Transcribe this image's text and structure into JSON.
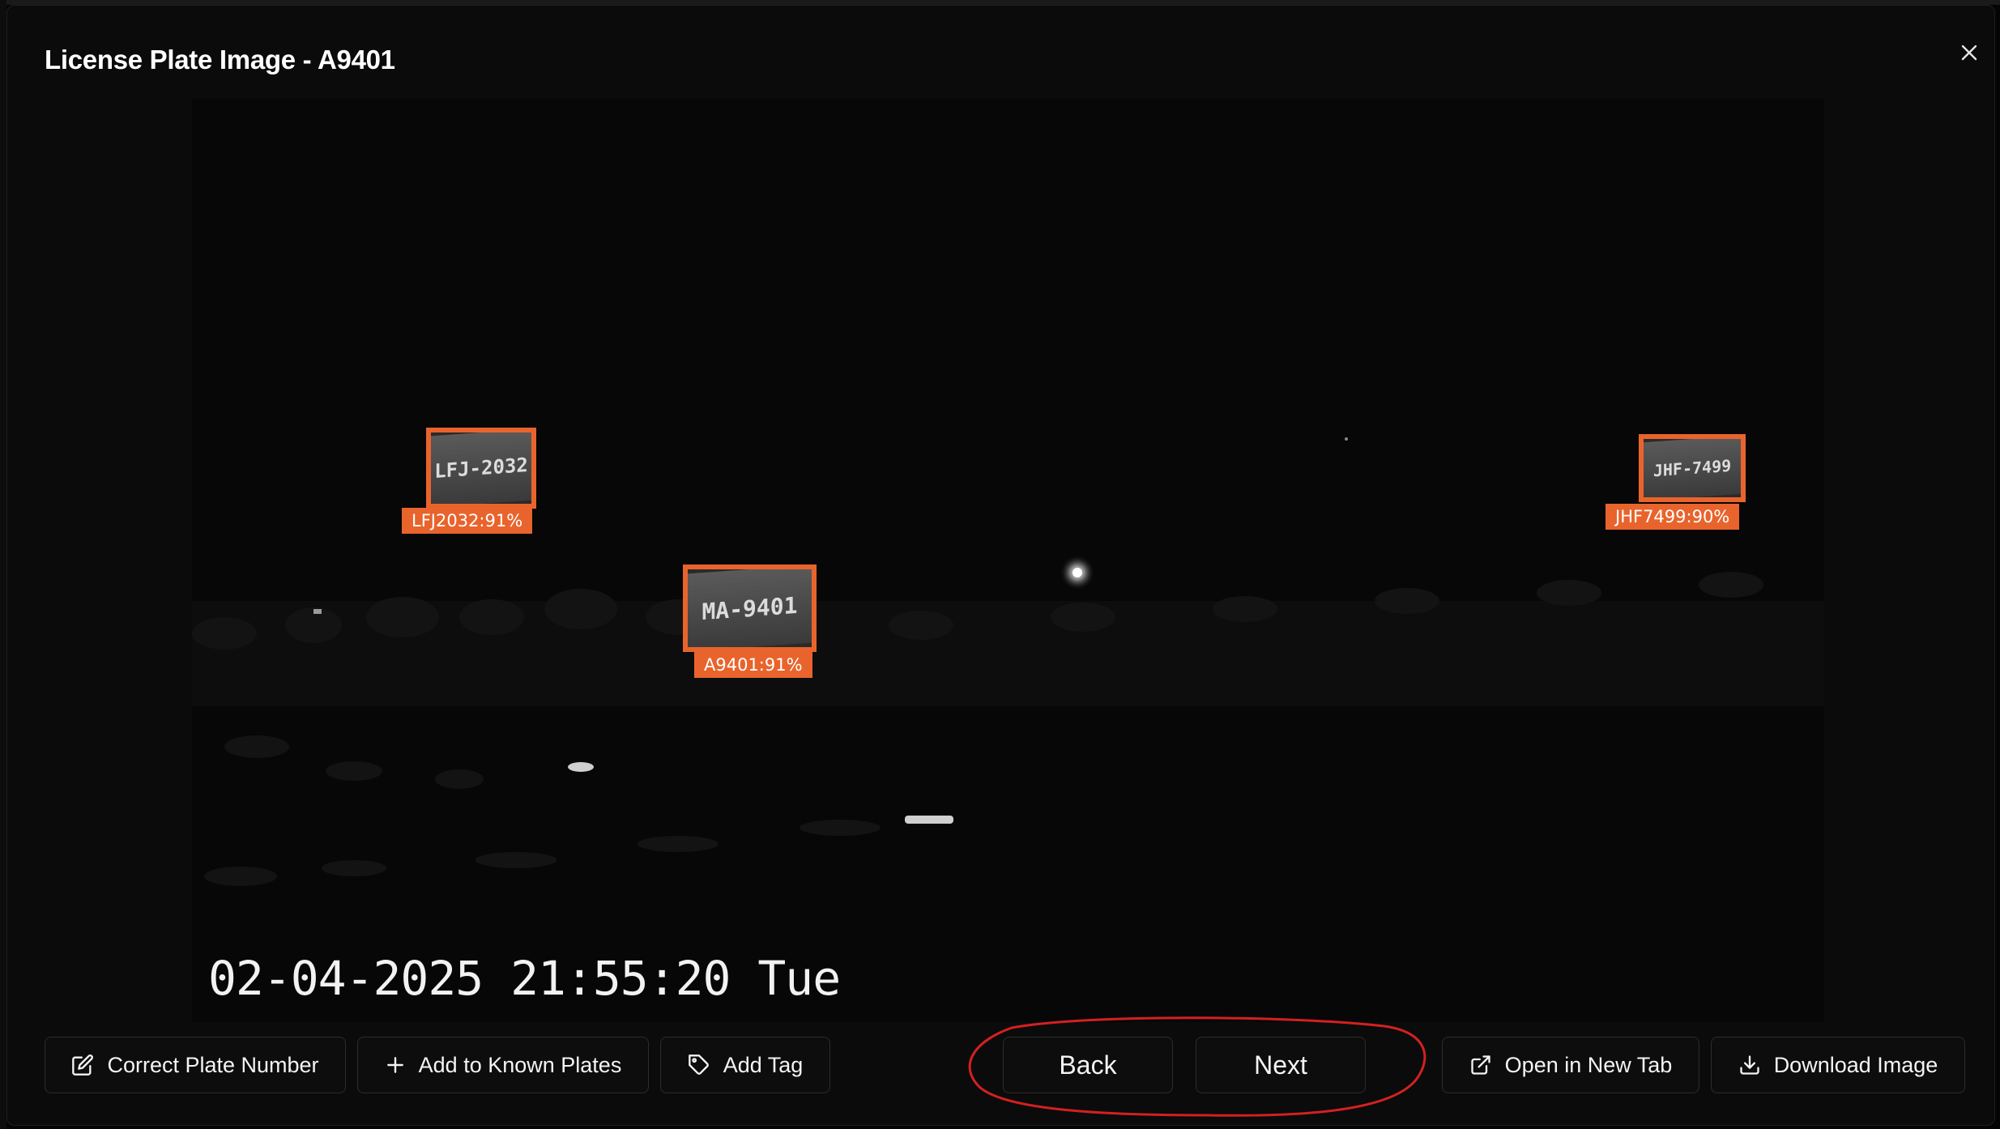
{
  "modal": {
    "title": "License Plate Image - A9401",
    "close_icon": "close-icon"
  },
  "image": {
    "timestamp": "02-04-2025 21:55:20 Tue",
    "detections": [
      {
        "id": "lfj",
        "plate_text": "LFJ-2032",
        "label": "LFJ2032:91%"
      },
      {
        "id": "a9401",
        "plate_text": "MA-9401",
        "label": "A9401:91%"
      },
      {
        "id": "jhf",
        "plate_text": "JHF-7499",
        "label": "JHF7499:90%"
      }
    ],
    "accent_color": "#e8642c"
  },
  "actions": {
    "correct_plate": {
      "label": "Correct Plate Number",
      "icon": "edit-icon"
    },
    "add_known": {
      "label": "Add to Known Plates",
      "icon": "plus-icon"
    },
    "add_tag": {
      "label": "Add Tag",
      "icon": "tag-icon"
    },
    "back": {
      "label": "Back"
    },
    "next": {
      "label": "Next"
    },
    "open_new_tab": {
      "label": "Open in New Tab",
      "icon": "external-link-icon"
    },
    "download": {
      "label": "Download Image",
      "icon": "download-icon"
    }
  }
}
